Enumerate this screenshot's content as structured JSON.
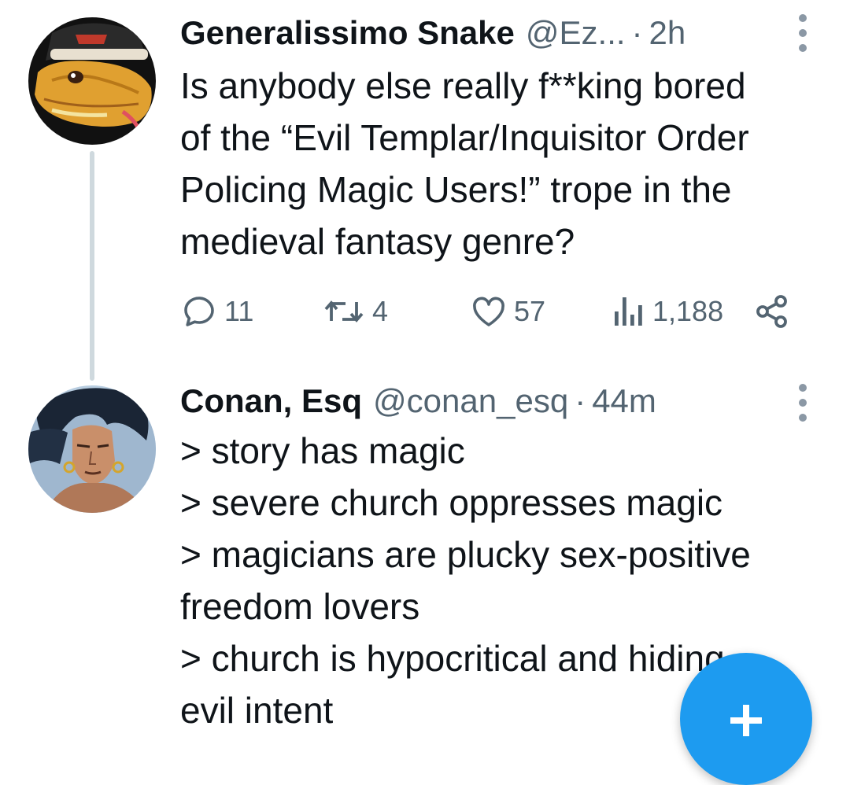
{
  "thread": [
    {
      "author": {
        "display_name": "Generalissimo Snake",
        "handle": "@Ez...",
        "avatar_icon": "snake-avatar"
      },
      "separator": "·",
      "time": "2h",
      "text_lines": [
        "Is anybody else really f**king bored",
        "of the “Evil Templar/Inquisitor Order",
        "Policing Magic Users!” trope in the",
        "medieval fantasy genre?"
      ],
      "metrics": {
        "replies": "11",
        "reposts": "4",
        "likes": "57",
        "views": "1,188"
      }
    },
    {
      "author": {
        "display_name": "Conan, Esq",
        "handle": "@conan_esq",
        "avatar_icon": "barbarian-avatar"
      },
      "separator": "·",
      "time": "44m",
      "text_lines": [
        "> story has magic",
        "> severe church oppresses magic",
        "> magicians are plucky sex-positive",
        "freedom lovers",
        "> church is hypocritical and hiding",
        "evil intent"
      ]
    }
  ],
  "icons": {
    "reply": "reply-icon",
    "repost": "repost-icon",
    "like": "heart-icon",
    "views": "views-icon",
    "share": "share-icon",
    "more": "more-vertical-icon",
    "compose": "plus-icon"
  },
  "colors": {
    "text": "#0f1419",
    "secondary": "#536471",
    "thread_line": "#cfd9de",
    "accent": "#1d9bf0"
  }
}
